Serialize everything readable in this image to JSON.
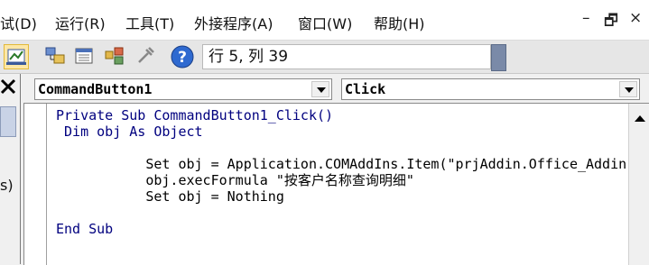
{
  "menu": [
    {
      "label": "试(D)"
    },
    {
      "label": "运行(R)"
    },
    {
      "label": "工具(T)"
    },
    {
      "label": "外接程序(A)"
    },
    {
      "label": "窗口(W)"
    },
    {
      "label": "帮助(H)"
    }
  ],
  "window_controls": {
    "minimize": "–",
    "restore": "🗗",
    "close": "×"
  },
  "toolbar": {
    "status_text": "行 5, 列 39",
    "icons": [
      "design-mode-icon",
      "project-explorer-icon",
      "properties-icon",
      "object-browser-icon",
      "toolbox-icon",
      "help-icon"
    ]
  },
  "left_panel": {
    "fragment_text": "s)"
  },
  "object_combo": {
    "value": "CommandButton1"
  },
  "procedure_combo": {
    "value": "Click"
  },
  "code": {
    "line1": "Private Sub CommandButton1_Click()",
    "line2": " Dim obj As Object",
    "line3": "",
    "line4": "           Set obj = Application.COMAddIns.Item(\"prjAddin.Office_Addin",
    "line5": "           obj.execFormula \"按客户名称查询明细\"",
    "line6": "           Set obj = Nothing",
    "line7": "",
    "line8": "End Sub"
  },
  "colors": {
    "keyword": "#00007f",
    "text": "#000000",
    "status_active": "#fde7a6"
  }
}
